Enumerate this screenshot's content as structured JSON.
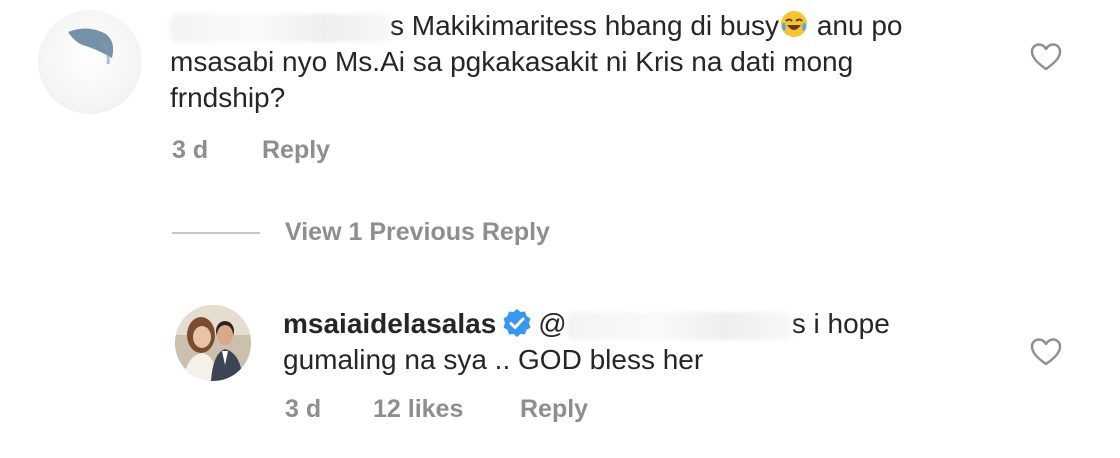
{
  "comment": {
    "text_line1": "s Makikimaritess hbang di busy",
    "text_after_emoji": " anu po",
    "text_line2": "msasabi nyo Ms.Ai sa  pgkakasakit ni Kris na dati mong",
    "text_line3": "frndship?",
    "emoji_icon": "face-with-tears-of-joy-icon",
    "time": "3 d",
    "reply_label": "Reply"
  },
  "view_replies": "View 1 Previous Reply",
  "reply": {
    "username": "msaiaidelasalas",
    "verified_icon": "verified-badge-icon",
    "mention_prefix": "@",
    "text_after_mention": "s i hope",
    "text_line2": "gumaling na sya .. GOD bless her",
    "time": "3 d",
    "likes": "12 likes",
    "reply_label": "Reply"
  },
  "colors": {
    "primary_text": "#262626",
    "secondary_text": "#8e8e8e",
    "verified": "#3897f0"
  }
}
